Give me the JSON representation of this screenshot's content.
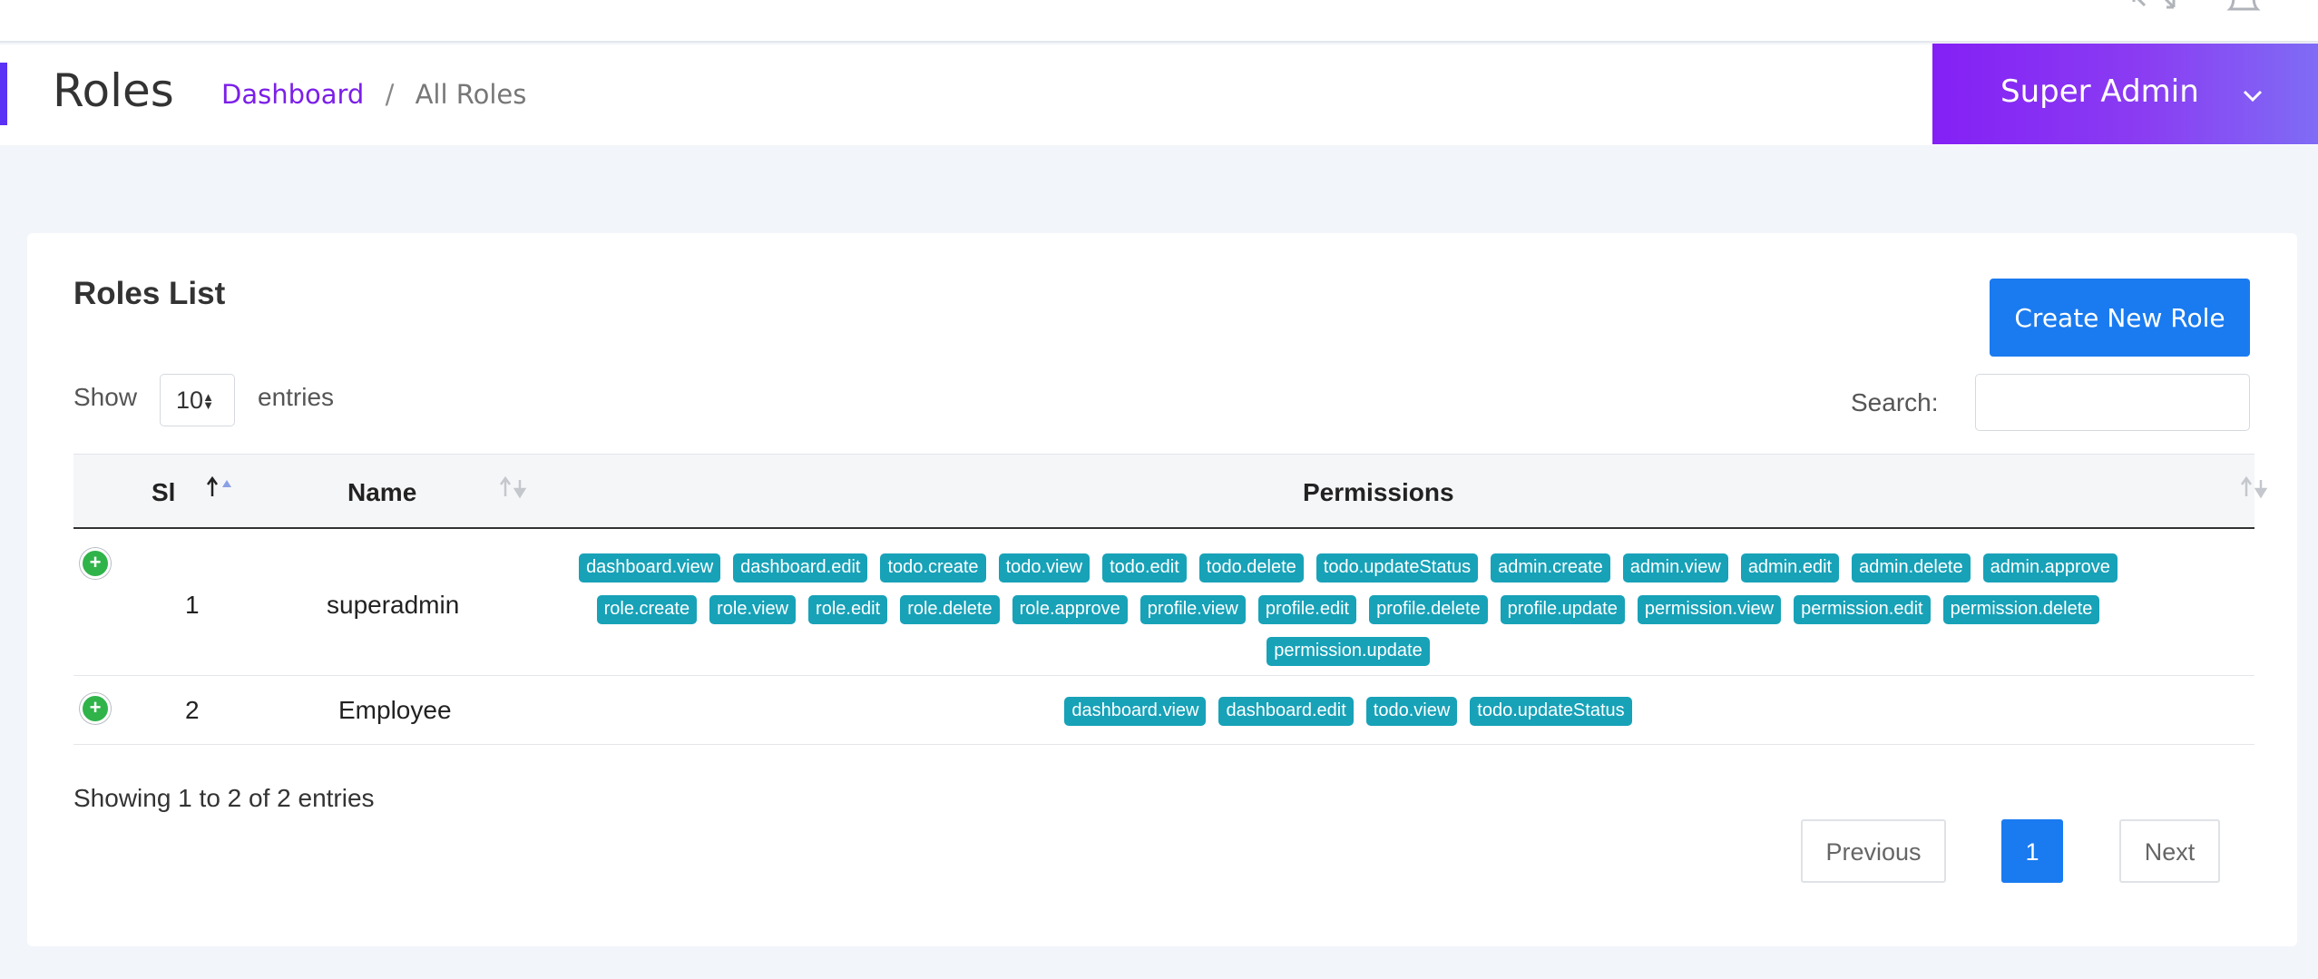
{
  "page": {
    "title": "Roles",
    "breadcrumb": {
      "link": "Dashboard",
      "separator": "/",
      "current": "All Roles"
    },
    "user_menu": {
      "name": "Super Admin"
    }
  },
  "card": {
    "title": "Roles List",
    "create_button": "Create New Role",
    "show_label": "Show",
    "page_length": "10",
    "entries_label": "entries",
    "search_label": "Search:",
    "search_value": ""
  },
  "table": {
    "columns": [
      "Sl",
      "Name",
      "Permissions"
    ],
    "rows": [
      {
        "sl": "1",
        "name": "superadmin",
        "permissions": [
          "dashboard.view",
          "dashboard.edit",
          "todo.create",
          "todo.view",
          "todo.edit",
          "todo.delete",
          "todo.updateStatus",
          "admin.create",
          "admin.view",
          "admin.edit",
          "admin.delete",
          "admin.approve",
          "role.create",
          "role.view",
          "role.edit",
          "role.delete",
          "role.approve",
          "profile.view",
          "profile.edit",
          "profile.delete",
          "profile.update",
          "permission.view",
          "permission.edit",
          "permission.delete",
          "permission.update"
        ]
      },
      {
        "sl": "2",
        "name": "Employee",
        "permissions": [
          "dashboard.view",
          "dashboard.edit",
          "todo.view",
          "todo.updateStatus"
        ]
      }
    ],
    "info": "Showing 1 to 2 of 2 entries"
  },
  "pagination": {
    "previous": "Previous",
    "current": "1",
    "next": "Next"
  },
  "colors": {
    "accent": "#7b1fe8",
    "primary_button": "#1a7bf0",
    "badge": "#17a2b8",
    "expand": "#30b44a"
  }
}
